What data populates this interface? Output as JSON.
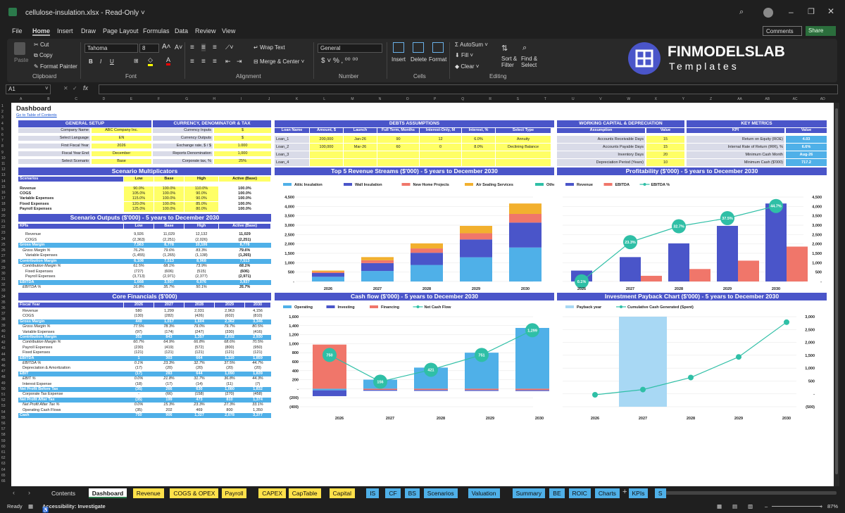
{
  "window": {
    "title": "cellulose-insulation.xlsx  -  Read-Only ˅"
  },
  "menu": [
    "File",
    "Home",
    "Insert",
    "Draw",
    "Page Layout",
    "Formulas",
    "Data",
    "Review",
    "View"
  ],
  "comments_label": "Comments",
  "share_label": "Share",
  "ribbon": {
    "paste": "Paste",
    "cut": "Cut",
    "copy": "Copy",
    "format_painter": "Format Painter",
    "clipboard": "Clipboard",
    "font_name": "Tahoma",
    "font_size": "8",
    "font_group": "Font",
    "wrap_text": "Wrap Text",
    "merge_center": "Merge & Center",
    "alignment": "Alignment",
    "number_format": "General",
    "number_group": "Number",
    "insert": "Insert",
    "delete": "Delete",
    "format": "Format",
    "cells": "Cells",
    "autosum": "AutoSum",
    "fill": "Fill",
    "clear": "Clear",
    "sort_filter": "Sort & Filter",
    "find_select": "Find & Select",
    "editing": "Editing"
  },
  "logo": {
    "line1": "FINMODELSLAB",
    "line2": "Templates"
  },
  "formula_bar": {
    "name_box": "A1",
    "fx": "fx"
  },
  "columns": [
    "A",
    "B",
    "C",
    "D",
    "E",
    "F",
    "G",
    "H",
    "I",
    "J",
    "K",
    "L",
    "M",
    "N",
    "O",
    "P",
    "Q",
    "R",
    "S",
    "T",
    "U",
    "V",
    "W",
    "X",
    "Y",
    "Z",
    "AA",
    "AB",
    "AC",
    "AD"
  ],
  "dashboard": {
    "title": "Dashboard",
    "toc_link": "Go to Table of Contents",
    "general_setup": {
      "header": "GENERAL SETUP",
      "rows": [
        [
          "Company Name",
          "ABC Company Inc."
        ],
        [
          "Select Language",
          "EN"
        ],
        [
          "First Fiscal Year",
          "2026"
        ],
        [
          "Fiscal Year End",
          "December"
        ],
        [
          "Select Scenario",
          "Base"
        ]
      ]
    },
    "currency": {
      "header": "CURRENCY, DENOMINATOR & TAX",
      "rows": [
        [
          "Currency Inputs",
          "$"
        ],
        [
          "Currency Outputs",
          "$"
        ],
        [
          "Exchange rate, $ / $",
          "1.000"
        ],
        [
          "Reports Denomination",
          "1,000"
        ],
        [
          "Corporate tax, %",
          "25%"
        ]
      ]
    },
    "debts": {
      "header": "DEBTS ASSUMPTIONS",
      "cols": [
        "Loan Name",
        "Amount, $",
        "Launch",
        "Full Term, Months",
        "Interest-Only, M",
        "Interest, %",
        "Select Type"
      ],
      "rows": [
        [
          "Loan_1",
          "200,000",
          "Jan-26",
          "90",
          "12",
          "6.0%",
          "Annuity"
        ],
        [
          "Loan_2",
          "100,000",
          "Mar-26",
          "60",
          "0",
          "8.0%",
          "Declining Balance"
        ],
        [
          "Loan_3",
          "",
          "",
          "",
          "",
          "",
          ""
        ],
        [
          "Loan_4",
          "",
          "",
          "",
          "",
          "",
          ""
        ]
      ]
    },
    "working_capital": {
      "header": "WORKING CAPITAL & DEPRECIATION",
      "cols": [
        "Assumption",
        "Value"
      ],
      "rows": [
        [
          "Accounts Receivable Days",
          "15"
        ],
        [
          "Accounts Payable Days",
          "15"
        ],
        [
          "Inventory Days",
          "20"
        ],
        [
          "Depreciation Period (Years)",
          "10"
        ]
      ]
    },
    "kpis": {
      "header": "KEY METRICS",
      "cols": [
        "KPI",
        "Value"
      ],
      "rows": [
        [
          "Return on Equity (ROE)",
          "4.03"
        ],
        [
          "Internal Rate of Return (IRR), %",
          "6.6%"
        ],
        [
          "Minimum Cash Month",
          "Aug-26"
        ],
        [
          "Minimum Cash ($'000)",
          "717.2"
        ]
      ]
    },
    "scenario_mult": {
      "header": "Scenario Multiplicators",
      "cols": [
        "Scenarios",
        "Low",
        "Base",
        "High",
        "Active (Base)"
      ],
      "rows": [
        [
          "Revenue",
          "90.0%",
          "100.0%",
          "110.0%",
          "100.0%"
        ],
        [
          "COGS",
          "105.0%",
          "100.0%",
          "90.0%",
          "100.0%"
        ],
        [
          "Variable Expenses",
          "115.0%",
          "100.0%",
          "90.0%",
          "100.0%"
        ],
        [
          "Fixed Expenses",
          "120.0%",
          "100.0%",
          "85.0%",
          "100.0%"
        ],
        [
          "Payroll Expenses",
          "125.0%",
          "100.0%",
          "80.0%",
          "100.0%"
        ]
      ]
    },
    "scenario_out": {
      "header": "Scenario Outputs ($'000) - 5 years to December 2030",
      "cols": [
        "KPIs",
        "Low",
        "Base",
        "High",
        "Active (Base)"
      ],
      "rows": [
        [
          "Revenue",
          "9,926",
          "11,029",
          "12,132",
          "11,029",
          "n"
        ],
        [
          "COGS",
          "(2,363)",
          "(2,251)",
          "(2,026)",
          "(2,251)",
          "n"
        ],
        [
          "Gross Margin",
          "7,563",
          "8,778",
          "10,106",
          "8,778",
          "b"
        ],
        [
          "Gross Margin %",
          "76.2%",
          "79.6%",
          "83.3%",
          "79.6%",
          "i"
        ],
        [
          "Variable Expenses",
          "(1,455)",
          "(1,265)",
          "(1,138)",
          "(1,265)",
          "n"
        ],
        [
          "Contribution Margin",
          "6,108",
          "7,513",
          "8,968",
          "7,513",
          "b"
        ],
        [
          "Contribution Margin %",
          "61.5%",
          "68.1%",
          "73.9%",
          "68.1%",
          "i"
        ],
        [
          "Fixed Expenses",
          "(727)",
          "(606)",
          "(515)",
          "(606)",
          "n"
        ],
        [
          "Payroll Expenses",
          "(3,713)",
          "(2,971)",
          "(2,377)",
          "(2,971)",
          "n"
        ],
        [
          "EBITDA",
          "1,668",
          "3,937",
          "6,076",
          "3,937",
          "b"
        ],
        [
          "EBITDA %",
          "16.8%",
          "35.7%",
          "50.1%",
          "35.7%",
          "i"
        ]
      ]
    },
    "core": {
      "header": "Core Financials ($'000)",
      "cols": [
        "Fiscal Year",
        "2026",
        "2027",
        "2028",
        "2029",
        "2030"
      ],
      "rows": [
        [
          "Revenue",
          "580",
          "1,299",
          "2,031",
          "2,963",
          "4,156",
          "n"
        ],
        [
          "COGS",
          "(130)",
          "(282)",
          "(426)",
          "(602)",
          "(810)",
          "n"
        ],
        [
          "Gross Margin",
          "449",
          "1,017",
          "1,604",
          "2,362",
          "3,346",
          "b"
        ],
        [
          "Gross Margin %",
          "77.5%",
          "78.3%",
          "79.0%",
          "79.7%",
          "80.5%",
          "i"
        ],
        [
          "Variable Expenses",
          "(97)",
          "(174)",
          "(247)",
          "(330)",
          "(416)",
          "n"
        ],
        [
          "Contribution Margin",
          "352",
          "843",
          "1,357",
          "2,032",
          "2,930",
          "b"
        ],
        [
          "Contribution Margin %",
          "60.7%",
          "64.9%",
          "66.8%",
          "68.6%",
          "70.5%",
          "i"
        ],
        [
          "Payroll Expenses",
          "(230)",
          "(419)",
          "(572)",
          "(800)",
          "(950)",
          "n"
        ],
        [
          "Fixed Expenses",
          "(121)",
          "(121)",
          "(121)",
          "(121)",
          "(121)",
          "n"
        ],
        [
          "EBITDA",
          "1",
          "303",
          "664",
          "1,110",
          "1,859",
          "b"
        ],
        [
          "EBITDA %",
          "0.1%",
          "23.3%",
          "32.7%",
          "37.5%",
          "44.7%",
          "i"
        ],
        [
          "Depreciation & Amortization",
          "(17)",
          "(20)",
          "(20)",
          "(20)",
          "(20)",
          "n"
        ],
        [
          "EBIT",
          "(17)",
          "283",
          "644",
          "1,090",
          "1,839",
          "b"
        ],
        [
          "EBIT %",
          "0.0%",
          "21.8%",
          "31.7%",
          "36.8%",
          "44.3%",
          "i"
        ],
        [
          "Interest Expense",
          "(18)",
          "(17)",
          "(14)",
          "(11)",
          "(7)",
          "n"
        ],
        [
          "Net Profit Before Tax",
          "(35)",
          "266",
          "630",
          "1,080",
          "1,832",
          "b"
        ],
        [
          "Corporate Tax Expense",
          "-",
          "(66)",
          "(158)",
          "(270)",
          "(458)",
          "n"
        ],
        [
          "Net Profit After Tax",
          "(35)",
          "199",
          "473",
          "810",
          "1,374",
          "b"
        ],
        [
          "Net Profit After Tax %",
          "0.0%",
          "15.3%",
          "23.3%",
          "27.3%",
          "33.1%",
          "i"
        ],
        [
          "Operating Cash Flows",
          "(35)",
          "202",
          "469",
          "800",
          "1,350",
          "n"
        ],
        [
          "Cash",
          "750",
          "906",
          "1,327",
          "2,078",
          "3,377",
          "b"
        ]
      ]
    }
  },
  "chart_data": [
    {
      "type": "bar",
      "stacked": true,
      "title": "Top 5 Revenue Streams ($'000) - 5 years to December 2030",
      "categories": [
        "2026",
        "2027",
        "2028",
        "2029",
        "2030"
      ],
      "series": [
        {
          "name": "Attic Insulation",
          "color": "#4fb0e8",
          "values": [
            250,
            560,
            880,
            1290,
            1810
          ]
        },
        {
          "name": "Wall Insulation",
          "color": "#4a55c9",
          "values": [
            200,
            420,
            650,
            950,
            1330
          ]
        },
        {
          "name": "New Home Projects",
          "color": "#f0766a",
          "values": [
            60,
            150,
            230,
            330,
            460
          ]
        },
        {
          "name": "Air Sealing Services",
          "color": "#f2b02e",
          "values": [
            70,
            169,
            271,
            393,
            556
          ]
        },
        {
          "name": "Other Revenue",
          "color": "#2fbfa6",
          "values": [
            0,
            0,
            0,
            0,
            0
          ]
        }
      ],
      "ylim": [
        0,
        4500
      ],
      "yticks": [
        "-",
        "500",
        "1,000",
        "1,500",
        "2,000",
        "2,500",
        "3,000",
        "3,500",
        "4,000",
        "4,500"
      ]
    },
    {
      "type": "bar+line",
      "title": "Profitability ($'000) - 5 years to December 2030",
      "categories": [
        "2026",
        "2027",
        "2028",
        "2029",
        "2030"
      ],
      "series": [
        {
          "name": "Revenue",
          "color": "#4a55c9",
          "values": [
            580,
            1299,
            2031,
            2963,
            4156
          ]
        },
        {
          "name": "EBITDA",
          "color": "#f0766a",
          "values": [
            1,
            303,
            664,
            1110,
            1859
          ]
        },
        {
          "name": "EBITDA %",
          "color": "#2fbfa6",
          "values": [
            0.1,
            23.3,
            32.7,
            37.5,
            44.7
          ],
          "labels": [
            "0.1%",
            "23.3%",
            "32.7%",
            "37.5%",
            "44.7%"
          ]
        }
      ],
      "ylim": [
        0,
        4500
      ],
      "yticks": [
        "-",
        "500",
        "1,000",
        "1,500",
        "2,000",
        "2,500",
        "3,000",
        "3,500",
        "4,000",
        "4,500"
      ]
    },
    {
      "type": "bar+line",
      "title": "Cash flow ($'000) - 5 years to December 2030",
      "categories": [
        "2026",
        "2027",
        "2028",
        "2029",
        "2030"
      ],
      "series": [
        {
          "name": "Operating",
          "color": "#4fb0e8",
          "values": [
            -35,
            202,
            469,
            800,
            1350
          ]
        },
        {
          "name": "Investing",
          "color": "#4a55c9",
          "values": [
            -130,
            -20,
            -20,
            -20,
            -20
          ]
        },
        {
          "name": "Financing",
          "color": "#f0766a",
          "values": [
            980,
            -26,
            -28,
            -29,
            -31
          ]
        },
        {
          "name": "Net Cash Flow",
          "color": "#2fbfa6",
          "values": [
            750,
            156,
            421,
            751,
            1299
          ],
          "labels": [
            "750",
            "156",
            "421",
            "751",
            "1,299"
          ]
        }
      ],
      "ylim": [
        -400,
        1600
      ],
      "yticks": [
        "(400)",
        "(200)",
        "-",
        "200",
        "400",
        "600",
        "800",
        "1,000",
        "1,200",
        "1,400",
        "1,600"
      ]
    },
    {
      "type": "bar+line",
      "title": "Investment Payback Chart ($'000) - 5 years to December 2030",
      "categories": [
        "2026",
        "2027",
        "2028",
        "2029",
        "2030"
      ],
      "series": [
        {
          "name": "Payback year",
          "color": "#a8d8f4",
          "values": [
            0,
            1,
            0,
            0,
            0
          ]
        },
        {
          "name": "Cumulative Cash Generated (Spent)",
          "color": "#2fbfa6",
          "values": [
            -35,
            167,
            636,
            1436,
            2786
          ]
        }
      ],
      "ylim": [
        -500,
        3000
      ],
      "yticks": [
        "(500)",
        "-",
        "500",
        "1,000",
        "1,500",
        "2,000",
        "2,500",
        "3,000"
      ]
    }
  ],
  "tabs": [
    {
      "label": "Contents",
      "bg": "#1f1f1f",
      "fg": "#ddd"
    },
    {
      "label": "Dashboard",
      "bg": "#ffffff",
      "fg": "#111"
    },
    {
      "label": "Revenue",
      "bg": "#ffe14a"
    },
    {
      "label": "COGS & OPEX",
      "bg": "#ffe14a"
    },
    {
      "label": "Payroll",
      "bg": "#ffe14a"
    },
    {
      "label": "CAPEX",
      "bg": "#ffe14a"
    },
    {
      "label": "CapTable",
      "bg": "#ffe14a"
    },
    {
      "label": "Capital",
      "bg": "#ffe14a"
    },
    {
      "label": "IS",
      "bg": "#4fb0e8"
    },
    {
      "label": "CF",
      "bg": "#4fb0e8"
    },
    {
      "label": "BS",
      "bg": "#4fb0e8"
    },
    {
      "label": "Scenarios",
      "bg": "#4fb0e8"
    },
    {
      "label": "Valuation",
      "bg": "#4fb0e8"
    },
    {
      "label": "Summary",
      "bg": "#4fb0e8"
    },
    {
      "label": "BE",
      "bg": "#4fb0e8"
    },
    {
      "label": "ROIC",
      "bg": "#4fb0e8"
    },
    {
      "label": "Charts",
      "bg": "#4fb0e8"
    },
    {
      "label": "KPIs",
      "bg": "#4fb0e8"
    },
    {
      "label": "S",
      "bg": "#4fb0e8"
    }
  ],
  "status": {
    "ready": "Ready",
    "accessibility": "Accessibility: Investigate",
    "zoom": "87%"
  }
}
